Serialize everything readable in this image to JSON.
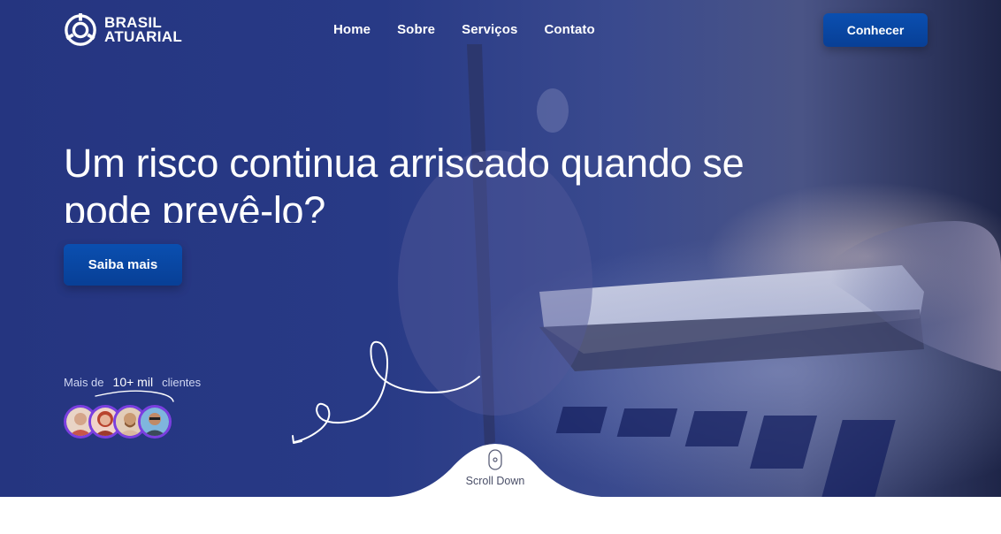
{
  "brand": {
    "line1": "BRASIL",
    "line2": "ATUARIAL"
  },
  "nav": {
    "items": [
      "Home",
      "Sobre",
      "Serviços",
      "Contato"
    ]
  },
  "header": {
    "cta_label": "Conhecer"
  },
  "hero": {
    "headline": "Um risco continua arriscado quando se pode prevê-lo?",
    "cta_label": "Saiba mais"
  },
  "social_proof": {
    "prefix": "Mais de",
    "highlight": "10+ mil",
    "suffix": "clientes"
  },
  "scroll": {
    "label": "Scroll Down"
  },
  "colors": {
    "hero_bg": "#283a86",
    "button": "#0a4fb0",
    "avatar_ring": "#7b3fe0"
  }
}
